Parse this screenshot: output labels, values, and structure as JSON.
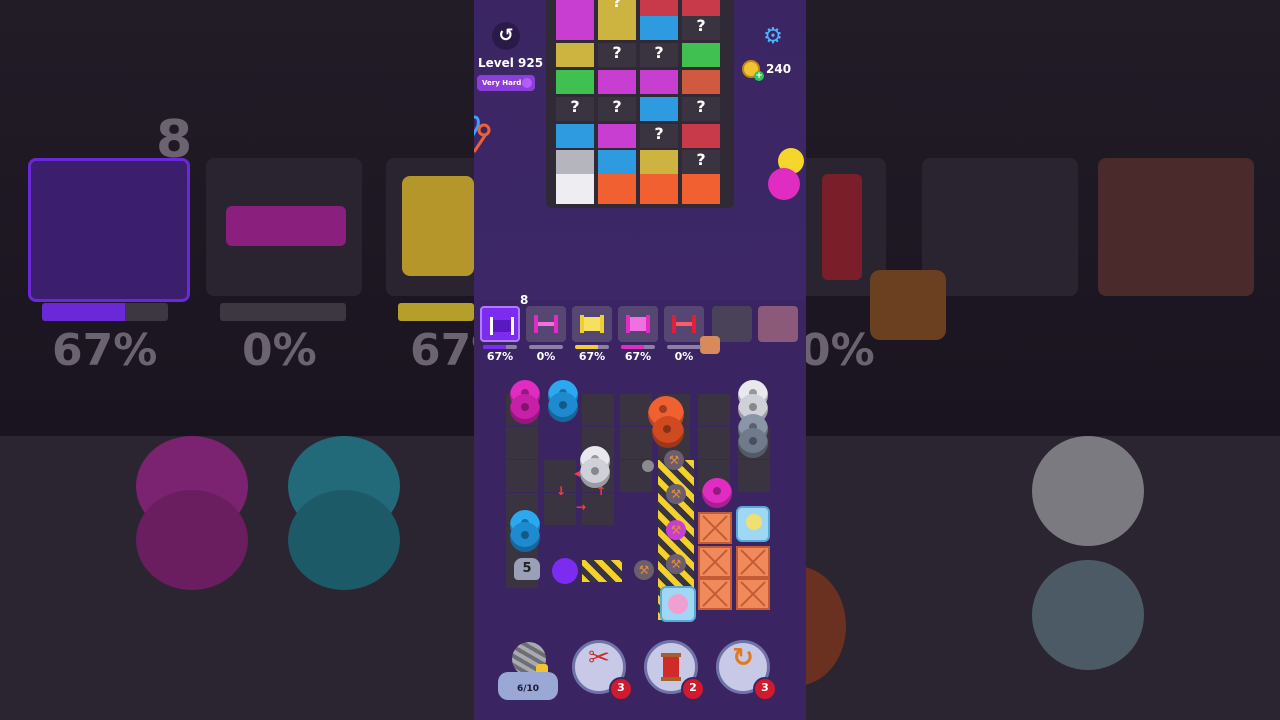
{
  "header": {
    "level_label": "Level 925",
    "difficulty": "Very Hard",
    "coins": "240",
    "undo_icon": "undo-icon",
    "settings_icon": "gear-icon"
  },
  "spool_slots": [
    {
      "color": "#7b2cf0",
      "percent_label": "67%",
      "progress": 0.67
    },
    {
      "color": "#e02cc0",
      "percent_label": "0%",
      "progress": 0.0
    },
    {
      "color": "#f0d030",
      "percent_label": "67%",
      "progress": 0.67
    },
    {
      "color": "#e02cc0",
      "percent_label": "67%",
      "progress": 0.67
    },
    {
      "color": "#e0203a",
      "percent_label": "0%",
      "progress": 0.0
    }
  ],
  "queue_count": "8",
  "board": {
    "locked_tile_count": "5"
  },
  "dock": {
    "yarn_progress": "6/10",
    "boosters": [
      {
        "name": "scissors",
        "icon": "✂",
        "count": "3"
      },
      {
        "name": "spool",
        "icon": "🧵",
        "count": "2"
      },
      {
        "name": "pin",
        "icon": "↻",
        "count": "3"
      }
    ]
  },
  "backdrop": {
    "queue_count": "8",
    "percent_labels": [
      "67%",
      "0%",
      "67%",
      "0%"
    ]
  },
  "colors": {
    "purple": "#7b2cf0",
    "magenta": "#e02cc0",
    "yellow": "#f0d030",
    "red": "#e0203a",
    "blue": "#2ca8f0",
    "orange": "#f06030",
    "white": "#e8e8ee",
    "grey": "#8a95a8",
    "green": "#40c050"
  }
}
